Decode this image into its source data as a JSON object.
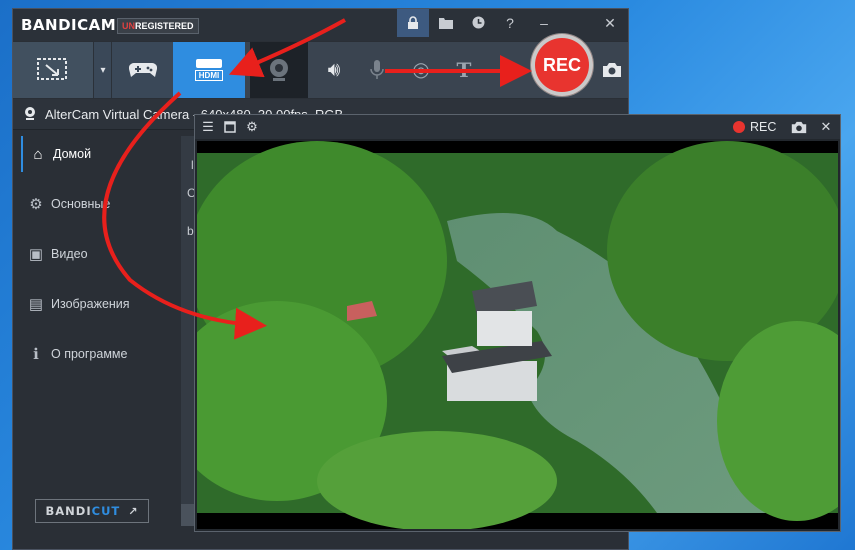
{
  "app": {
    "logo_main": "BANDI",
    "logo_cam": "CAM",
    "badge_un": "UN",
    "badge_rest": "REGISTERED"
  },
  "titlebar_icons": [
    "lock-icon",
    "folder-icon",
    "clock-icon",
    "help-icon",
    "minimize-icon",
    "close-icon"
  ],
  "toolbar": {
    "modes": [
      "screen-rectangle",
      "dropdown",
      "game",
      "hdmi",
      "webcam"
    ],
    "hdmi_label": "HDMI",
    "rec_label": "REC"
  },
  "device": {
    "label": "AlterCam Virtual Camera - 640x480, 30.00fps, RGB"
  },
  "sidebar": {
    "items": [
      {
        "label": "Домой",
        "icon": "home-icon"
      },
      {
        "label": "Основные",
        "icon": "gear-icon"
      },
      {
        "label": "Видео",
        "icon": "video-settings-icon"
      },
      {
        "label": "Изображения",
        "icon": "image-settings-icon"
      },
      {
        "label": "О программе",
        "icon": "info-icon"
      }
    ],
    "bandicut_a": "BANDI",
    "bandicut_b": "CUT"
  },
  "content_fragments": [
    "l",
    "C",
    "b"
  ],
  "preview": {
    "rec_label": "REC"
  },
  "colors": {
    "accent": "#2f8de0",
    "rec": "#e8342f",
    "arrow": "#e8201c",
    "background": "#1b6fc8"
  }
}
